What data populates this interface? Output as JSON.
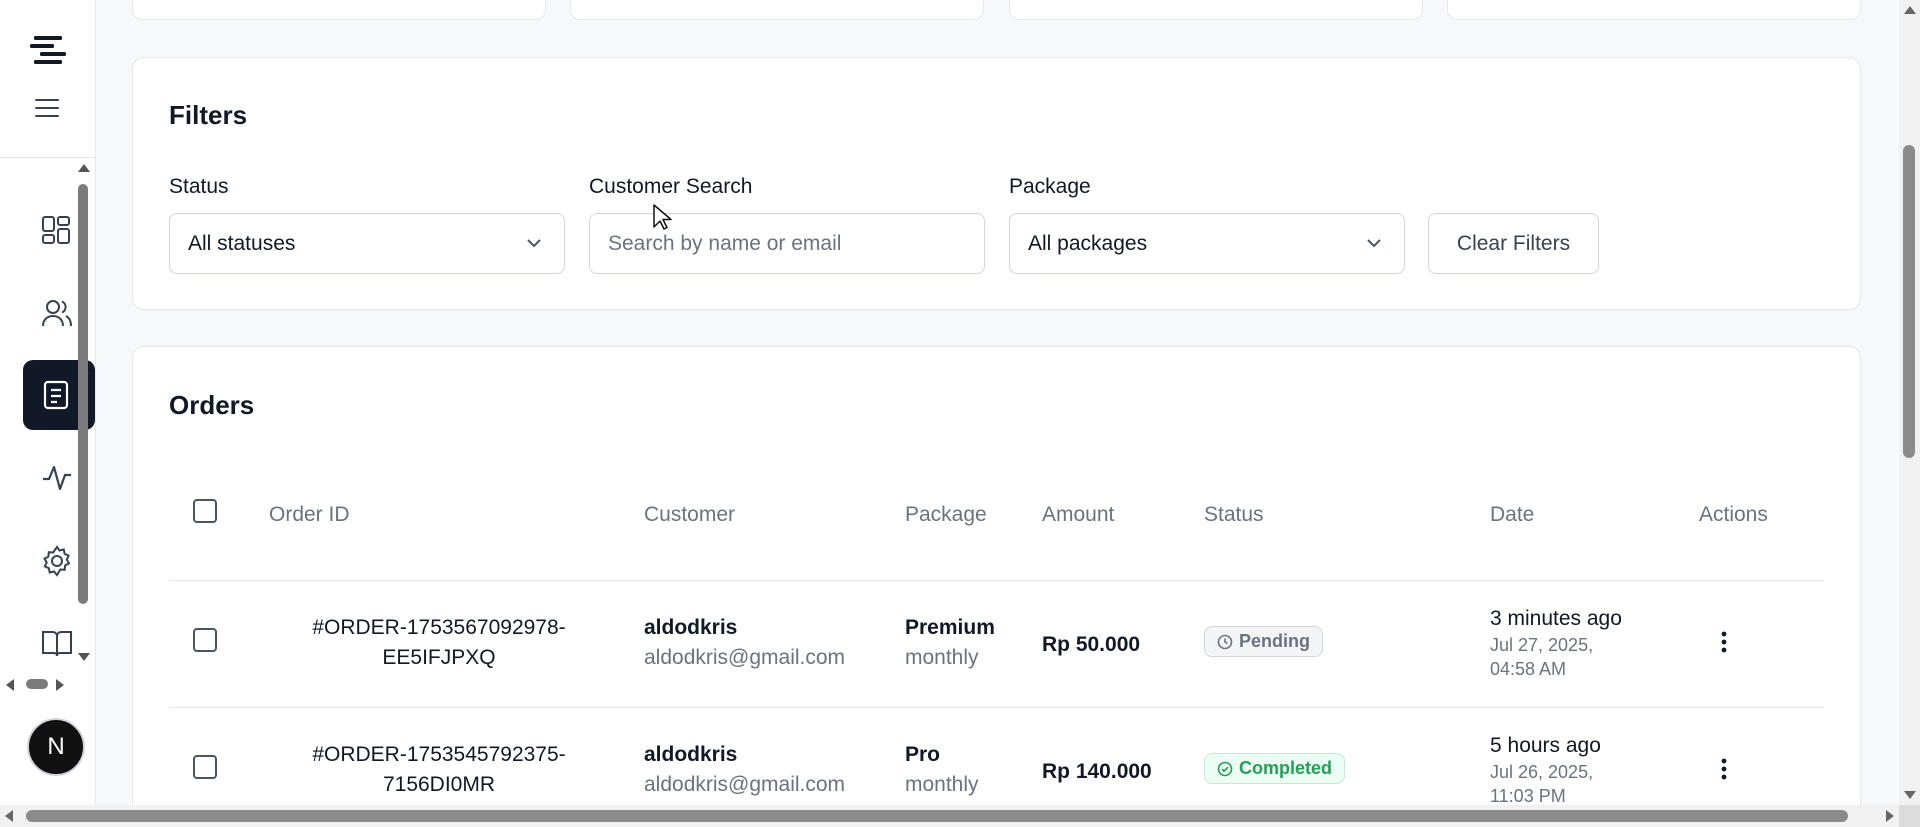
{
  "app": {
    "logo_icon": "stacked-lines-logo",
    "avatar_letter": "N"
  },
  "sidebar": {
    "items": [
      {
        "icon": "dashboard-icon",
        "active": false
      },
      {
        "icon": "users-icon",
        "active": false
      },
      {
        "icon": "orders-icon",
        "active": true
      },
      {
        "icon": "activity-icon",
        "active": false
      },
      {
        "icon": "settings-icon",
        "active": false
      },
      {
        "icon": "docs-icon",
        "active": false
      }
    ]
  },
  "filters": {
    "title": "Filters",
    "status_label": "Status",
    "status_value": "All statuses",
    "search_label": "Customer Search",
    "search_placeholder": "Search by name or email",
    "package_label": "Package",
    "package_value": "All packages",
    "clear_label": "Clear Filters"
  },
  "orders": {
    "title": "Orders",
    "columns": {
      "order_id": "Order ID",
      "customer": "Customer",
      "package": "Package",
      "amount": "Amount",
      "status": "Status",
      "date": "Date",
      "actions": "Actions"
    },
    "rows": [
      {
        "id_line1": "#ORDER-1753567092978-",
        "id_line2": "EE5IFJPXQ",
        "customer_name": "aldodkris",
        "customer_email": "aldodkris@gmail.com",
        "package_name": "Premium",
        "package_period": "monthly",
        "amount": "Rp 50.000",
        "status": "Pending",
        "date_relative": "3 minutes ago",
        "date_absolute": "Jul 27, 2025, 04:58 AM"
      },
      {
        "id_line1": "#ORDER-1753545792375-",
        "id_line2": "7156DI0MR",
        "customer_name": "aldodkris",
        "customer_email": "aldodkris@gmail.com",
        "package_name": "Pro",
        "package_period": "monthly",
        "amount": "Rp 140.000",
        "status": "Completed",
        "date_relative": "5 hours ago",
        "date_absolute": "Jul 26, 2025, 11:03 PM"
      }
    ]
  },
  "colors": {
    "active_nav": "#111827",
    "pending": "#6b7280",
    "completed": "#22a055"
  }
}
